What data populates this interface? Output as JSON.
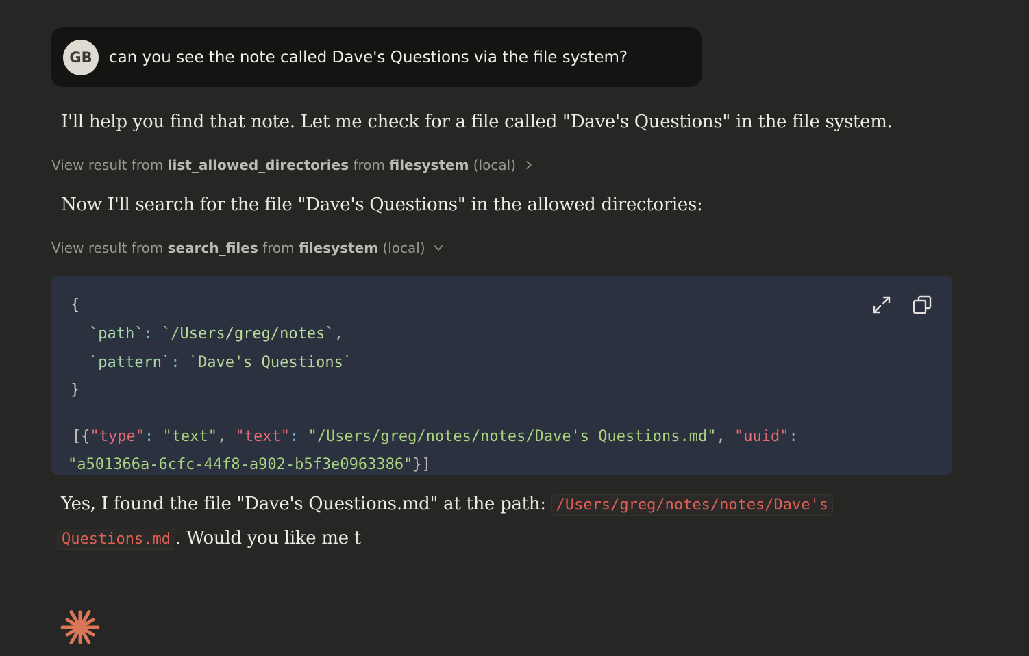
{
  "user_message": {
    "avatar_initials": "GB",
    "text": "can you see the note called Dave's Questions via the file system?"
  },
  "assistant": {
    "paragraph_1": "I'll help you find that note. Let me check for a file called \"Dave's Questions\" in the file system.",
    "tool_1": {
      "prefix": "View result from ",
      "tool_name": "list_allowed_directories",
      "from_word": " from ",
      "server": "filesystem",
      "location": " (local)",
      "state_icon": "chevron-right-icon"
    },
    "paragraph_2": "Now I'll search for the file \"Dave's Questions\" in the allowed directories:",
    "tool_2": {
      "prefix": "View result from ",
      "tool_name": "search_files",
      "from_word": " from ",
      "server": "filesystem",
      "location": " (local)",
      "state_icon": "chevron-down-icon"
    },
    "code": {
      "open_brace": "{",
      "path_key": "`path`",
      "path_colon": ":",
      "path_value": " `/Users/greg/notes`",
      "path_comma": ",",
      "pattern_key": "`pattern`",
      "pattern_colon": ":",
      "pattern_value": " `Dave's Questions`",
      "close_brace": "}",
      "result_open": "[{",
      "result_type_key": "\"type\"",
      "result_type_value": "\"text\"",
      "result_text_key": "\"text\"",
      "result_text_value": "\"/Users/greg/notes/notes/Dave's Questions.md\"",
      "result_uuid_key": "\"uuid\"",
      "result_uuid_value": "\"a501366a-6cfc-44f8-a902-b5f3e0963386\"",
      "result_close": "}]",
      "colon_space": ": ",
      "comma_space": ", ",
      "expand_icon": "expand-icon",
      "copy_icon": "copy-icon"
    },
    "paragraph_3_lead": "Yes, I found the file \"Dave's Questions.md\" at the path: ",
    "paragraph_3_code_line1": "/Users/greg/notes/notes/Dave's",
    "paragraph_3_code_line2": "Questions.md",
    "paragraph_3_tail": ". Would you like me t"
  },
  "colors": {
    "background": "#262624",
    "user_bubble": "#141413",
    "code_background": "#2c3140",
    "inline_code": "#e06055",
    "json_key": "#e06c75",
    "json_string": "#a9d27f",
    "brand_logo": "#d97757"
  },
  "logo_icon": "claude-spark-icon"
}
